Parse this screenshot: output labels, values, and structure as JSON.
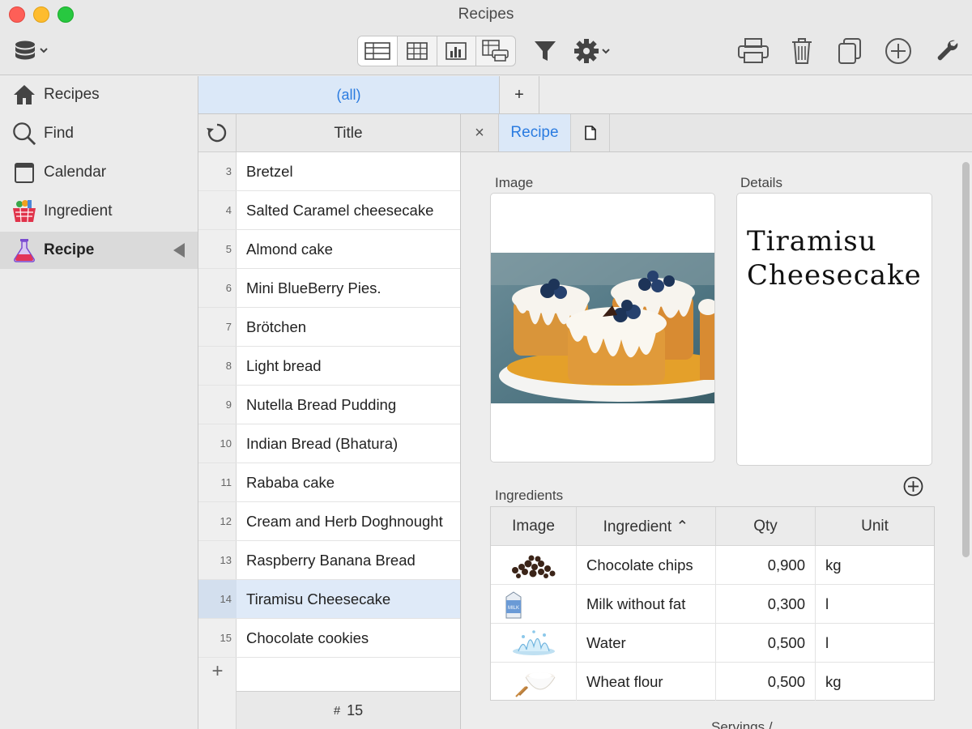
{
  "window": {
    "title": "Recipes"
  },
  "toolbar": {
    "icons": [
      "database-icon",
      "form-view-icon",
      "table-view-icon",
      "chart-view-icon",
      "print-layout-icon",
      "filter-icon",
      "gear-icon",
      "printer-icon",
      "trash-icon",
      "duplicate-icon",
      "add-circle-icon",
      "wrench-icon"
    ]
  },
  "sidebar": {
    "items": [
      {
        "label": "Recipes",
        "icon": "home-icon"
      },
      {
        "label": "Find",
        "icon": "search-icon"
      },
      {
        "label": "Calendar",
        "icon": "calendar-icon"
      },
      {
        "label": "Ingredient",
        "icon": "basket-icon"
      },
      {
        "label": "Recipe",
        "icon": "flask-icon",
        "active": true
      }
    ]
  },
  "filter_tabs": {
    "all_label": "(all)",
    "add_label": "+"
  },
  "list": {
    "header": "Title",
    "rows": [
      {
        "num": "3",
        "title": "Bretzel"
      },
      {
        "num": "4",
        "title": "Salted Caramel cheesecake"
      },
      {
        "num": "5",
        "title": "Almond cake"
      },
      {
        "num": "6",
        "title": "Mini BlueBerry Pies."
      },
      {
        "num": "7",
        "title": "Brötchen"
      },
      {
        "num": "8",
        "title": "Light bread"
      },
      {
        "num": "9",
        "title": "Nutella Bread Pudding"
      },
      {
        "num": "10",
        "title": "Indian Bread (Bhatura)"
      },
      {
        "num": "11",
        "title": "Rababa cake"
      },
      {
        "num": "12",
        "title": "Cream and Herb Doghnought"
      },
      {
        "num": "13",
        "title": "Raspberry Banana Bread"
      },
      {
        "num": "14",
        "title": "Tiramisu Cheesecake",
        "selected": true
      },
      {
        "num": "15",
        "title": "Chocolate cookies"
      }
    ],
    "add_label": "+",
    "footer_hash": "#",
    "footer_count": "15"
  },
  "detail_tabs": {
    "close_label": "×",
    "recipe_label": "Recipe"
  },
  "detail": {
    "image_label": "Image",
    "details_label": "Details",
    "recipe_title": "Tiramisu Cheesecake",
    "ingredients_label": "Ingredients",
    "servings_label": "Servings /"
  },
  "ingredients": {
    "headers": {
      "image": "Image",
      "ingredient": "Ingredient ⌃",
      "qty": "Qty",
      "unit": "Unit"
    },
    "rows": [
      {
        "name": "Chocolate chips",
        "qty": "0,900",
        "unit": "kg",
        "thumb": "chocolate-chips-thumb"
      },
      {
        "name": "Milk without fat",
        "qty": "0,300",
        "unit": "l",
        "thumb": "milk-carton-thumb"
      },
      {
        "name": "Water",
        "qty": "0,500",
        "unit": "l",
        "thumb": "water-splash-thumb"
      },
      {
        "name": "Wheat flour",
        "qty": "0,500",
        "unit": "kg",
        "thumb": "flour-bowl-thumb"
      }
    ]
  },
  "colors": {
    "accent": "#2a7be0",
    "selection": "#dfeaf8"
  }
}
